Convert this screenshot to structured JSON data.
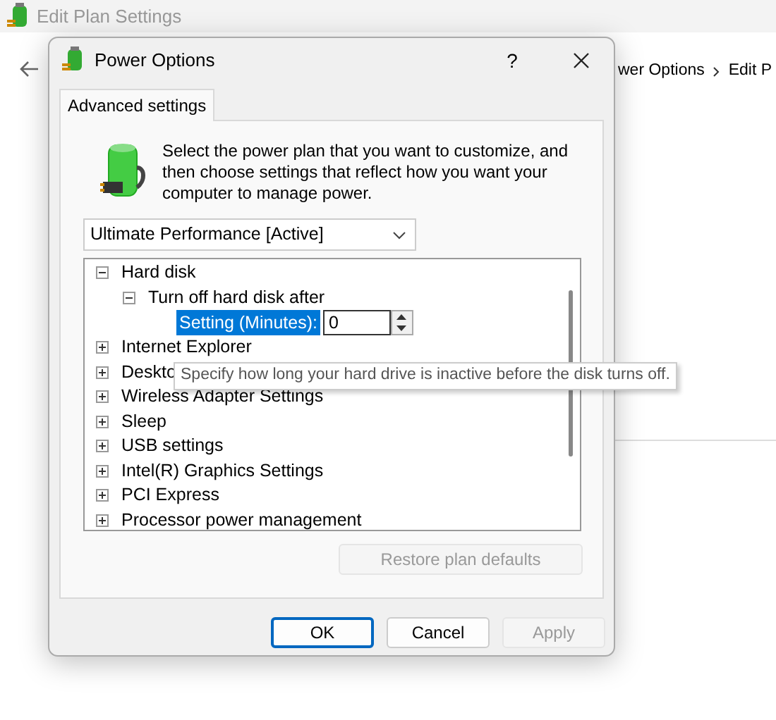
{
  "background_window": {
    "title": "Edit Plan Settings",
    "breadcrumb": [
      "wer Options",
      "Edit P"
    ]
  },
  "dialog": {
    "title": "Power Options",
    "help_button": "?",
    "tabs": [
      {
        "label": "Advanced settings",
        "selected": true
      }
    ],
    "description": "Select the power plan that you want to customize, and then choose settings that reflect how you want your computer to manage power.",
    "plan_dropdown": {
      "value": "Ultimate Performance [Active]"
    },
    "tree": [
      {
        "label": "Hard disk",
        "expanded": true,
        "children": [
          {
            "label": "Turn off hard disk after",
            "expanded": true,
            "setting": {
              "label": "Setting (Minutes):",
              "value": "0",
              "selected": true
            }
          }
        ]
      },
      {
        "label": "Internet Explorer",
        "expanded": false
      },
      {
        "label": "Deskto",
        "expanded": false
      },
      {
        "label": "Wireless Adapter Settings",
        "expanded": false
      },
      {
        "label": "Sleep",
        "expanded": false
      },
      {
        "label": "USB settings",
        "expanded": false
      },
      {
        "label": "Intel(R) Graphics Settings",
        "expanded": false
      },
      {
        "label": "PCI Express",
        "expanded": false
      },
      {
        "label": "Processor power management",
        "expanded": false
      }
    ],
    "tooltip": "Specify how long your hard drive is inactive before the disk turns off.",
    "restore_button": {
      "label": "Restore plan defaults",
      "disabled": true
    },
    "buttons": [
      {
        "label": "OK",
        "kind": "default",
        "disabled": false
      },
      {
        "label": "Cancel",
        "kind": "normal",
        "disabled": false
      },
      {
        "label": "Apply",
        "kind": "normal",
        "disabled": true
      }
    ]
  }
}
